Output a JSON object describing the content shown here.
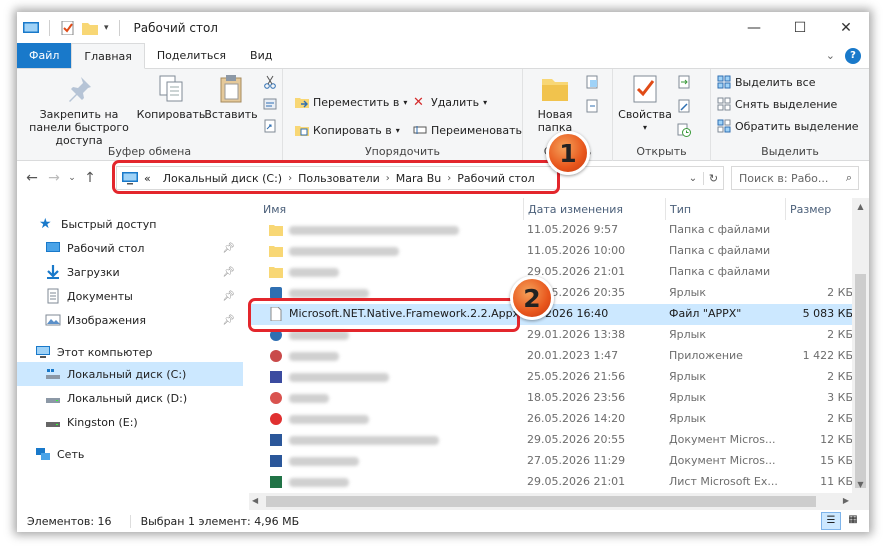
{
  "window": {
    "title": "Рабочий стол"
  },
  "tabs": [
    {
      "label": "Файл"
    },
    {
      "label": "Главная"
    },
    {
      "label": "Поделиться"
    },
    {
      "label": "Вид"
    }
  ],
  "ribbon": {
    "clipboard": {
      "label": "Буфер обмена",
      "pin": "Закрепить на панели быстрого доступа",
      "copy": "Копировать",
      "paste": "Вставить"
    },
    "organize": {
      "label": "Упорядочить",
      "move": "Переместить в",
      "copy_to": "Копировать в",
      "delete": "Удалить",
      "rename": "Переименовать"
    },
    "new": {
      "label": "Создать",
      "new_folder": "Новая папка"
    },
    "open": {
      "label": "Открыть",
      "properties": "Свойства"
    },
    "select": {
      "label": "Выделить",
      "select_all": "Выделить все",
      "select_none": "Снять выделение",
      "invert": "Обратить выделение"
    }
  },
  "address": {
    "prefix": "«",
    "segments": [
      "Локальный диск (C:)",
      "Пользователи",
      "Mara Bu",
      "Рабочий стол"
    ],
    "search_placeholder": "Поиск в: Рабо..."
  },
  "nav": {
    "items": [
      {
        "label": "Быстрый доступ"
      },
      {
        "label": "Рабочий стол"
      },
      {
        "label": "Загрузки"
      },
      {
        "label": "Документы"
      },
      {
        "label": "Изображения"
      },
      {
        "label": "Этот компьютер"
      },
      {
        "label": "Локальный диск (C:)"
      },
      {
        "label": "Локальный диск (D:)"
      },
      {
        "label": "Kingston (E:)"
      },
      {
        "label": "Сеть"
      }
    ]
  },
  "columns": {
    "name": "Имя",
    "date": "Дата изменения",
    "type": "Тип",
    "size": "Размер"
  },
  "files": [
    {
      "date": "11.05.2026 9:57",
      "type": "Папка с файлами",
      "size": ""
    },
    {
      "date": "11.05.2026 10:00",
      "type": "Папка с файлами",
      "size": ""
    },
    {
      "date": "29.05.2026 21:01",
      "type": "Папка с файлами",
      "size": ""
    },
    {
      "date": "29.05.2026 20:35",
      "type": "Ярлык",
      "size": "2 КБ"
    },
    {
      "name": "Microsoft.NET.Native.Framework.2.2.Appx",
      "date": "2026 16:40",
      "type": "Файл \"APPX\"",
      "size": "5 083 КБ"
    },
    {
      "date": "29.01.2026 13:38",
      "type": "Ярлык",
      "size": "2 КБ"
    },
    {
      "date": "20.01.2023 1:47",
      "type": "Приложение",
      "size": "1 422 КБ"
    },
    {
      "date": "25.05.2026 21:56",
      "type": "Ярлык",
      "size": "2 КБ"
    },
    {
      "date": "18.05.2026 23:56",
      "type": "Ярлык",
      "size": "3 КБ"
    },
    {
      "date": "26.05.2026 14:20",
      "type": "Ярлык",
      "size": "2 КБ"
    },
    {
      "date": "29.05.2026 20:55",
      "type": "Документ Micros...",
      "size": "12 КБ"
    },
    {
      "date": "27.05.2026 11:29",
      "type": "Документ Micros...",
      "size": "15 КБ"
    },
    {
      "date": "29.05.2026 21:01",
      "type": "Лист Microsoft Ex...",
      "size": "11 КБ"
    }
  ],
  "status": {
    "count": "Элементов: 16",
    "selected": "Выбран 1 элемент: 4,96 МБ"
  },
  "callouts": {
    "one": "1",
    "two": "2"
  },
  "colors": {
    "accent": "#1979ca",
    "selection": "#cce8ff",
    "callout": "#e3262c",
    "badge": "#e8561c"
  }
}
